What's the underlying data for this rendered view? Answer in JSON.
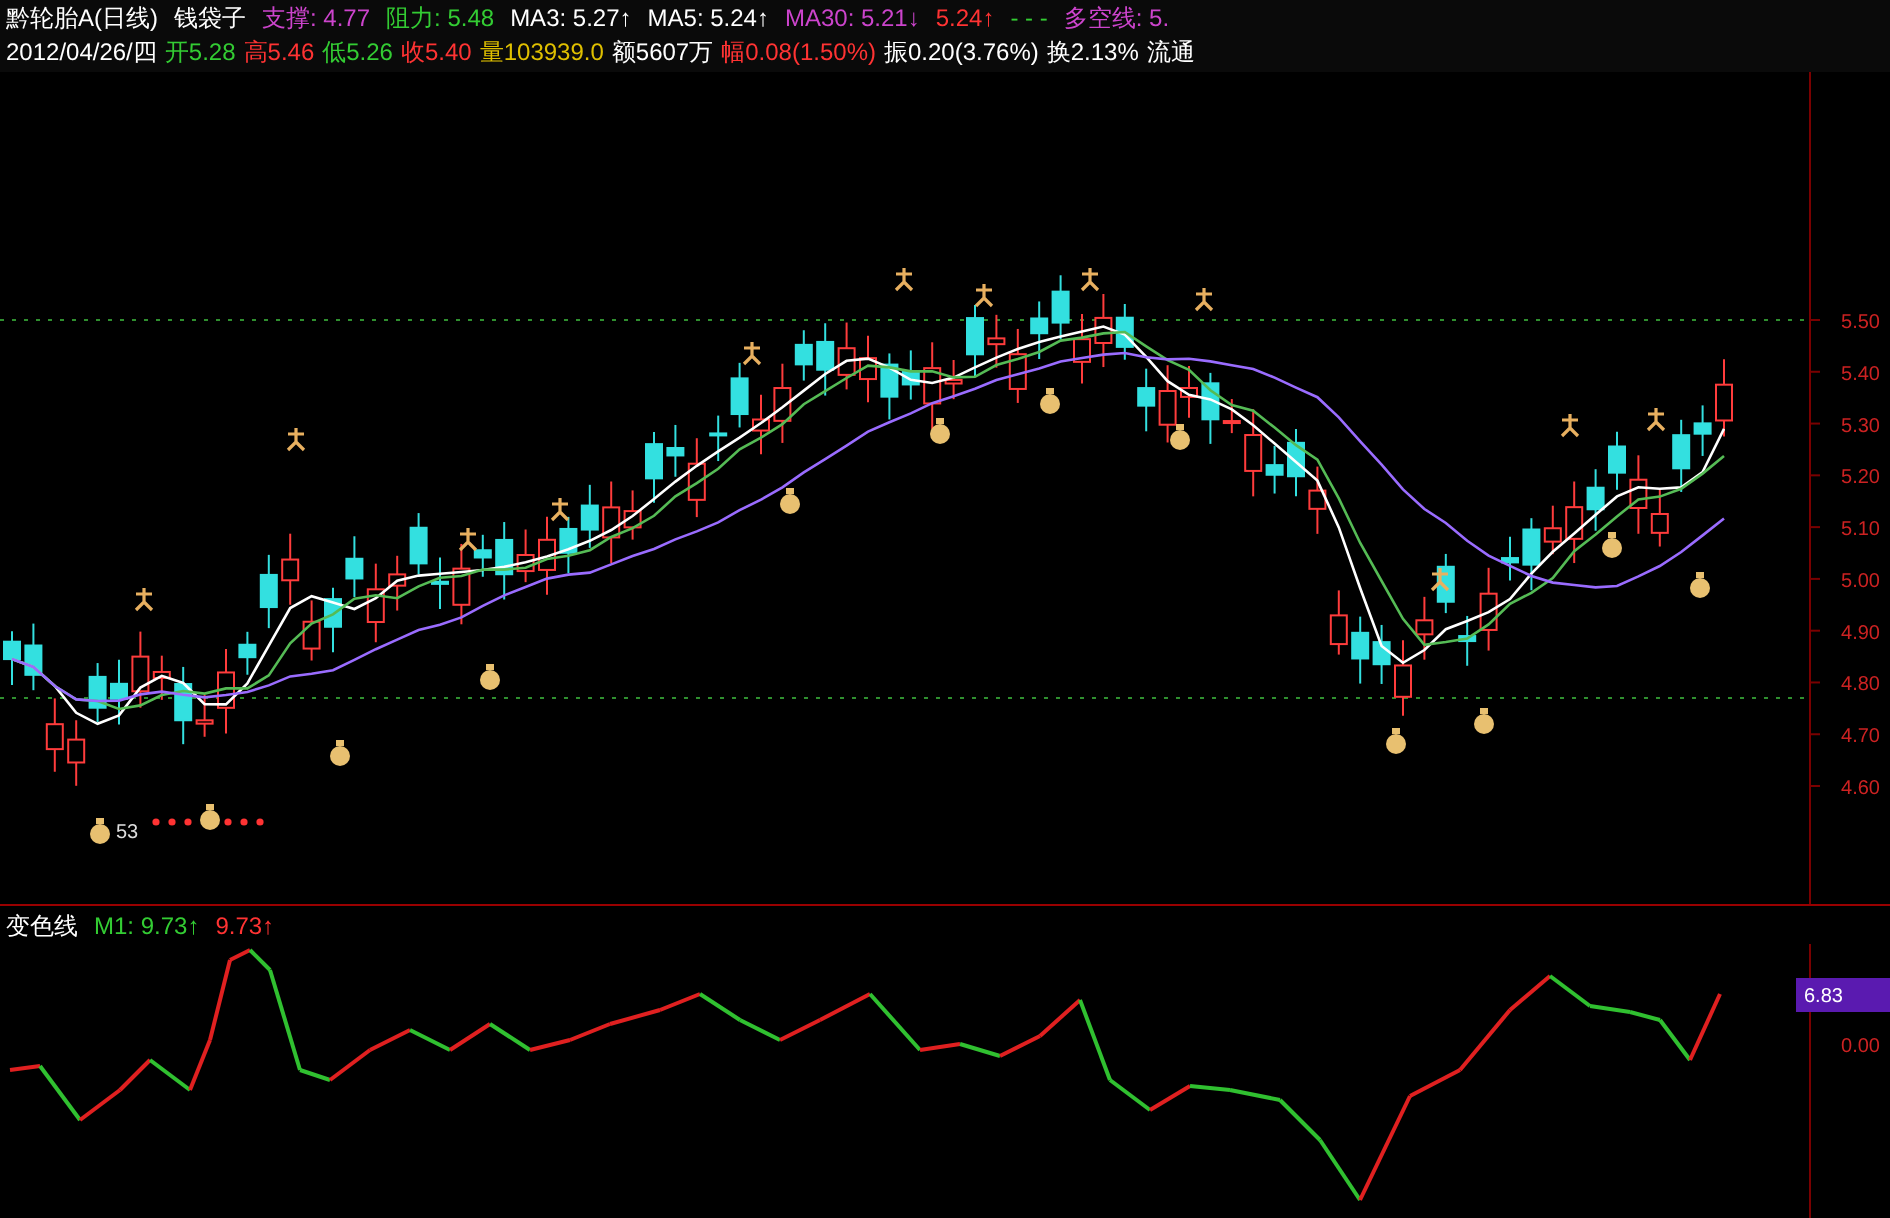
{
  "header": {
    "row_1": [
      {
        "text": "黔轮胎A(日线)",
        "color": "#ffffff"
      },
      {
        "text": "钱袋子",
        "color": "#ffffff"
      },
      {
        "text": "支撑: 4.77",
        "color": "#cc44cc"
      },
      {
        "text": "阻力: 5.48",
        "color": "#33cc33"
      },
      {
        "text": "MA3: 5.27↑",
        "color": "#ffffff"
      },
      {
        "text": "MA5: 5.24↑",
        "color": "#ffffff"
      },
      {
        "text": "MA30: 5.21↓",
        "color": "#cc44cc"
      },
      {
        "text": "5.24↑",
        "color": "#ff3333"
      },
      {
        "text": "- - -",
        "color": "#33cc33"
      },
      {
        "text": "多空线: 5.",
        "color": "#cc44cc"
      }
    ],
    "row_2": [
      {
        "text": "2012/04/26/四",
        "color": "#ffffff"
      },
      {
        "text": "开5.28",
        "color": "#33cc33"
      },
      {
        "text": "高5.46",
        "color": "#ff3333"
      },
      {
        "text": "低5.26",
        "color": "#33cc33"
      },
      {
        "text": "收5.40",
        "color": "#ff3333"
      },
      {
        "text": "量103939.0",
        "color": "#e0c000"
      },
      {
        "text": "额5607万",
        "color": "#ffffff"
      },
      {
        "text": "幅0.08(1.50%)",
        "color": "#ff3333"
      },
      {
        "text": "振0.20(3.76%)",
        "color": "#ffffff"
      },
      {
        "text": "换2.13%",
        "color": "#ffffff"
      },
      {
        "text": "流通",
        "color": "#ffffff"
      }
    ]
  },
  "price_axis": {
    "ticks": [
      "5.50",
      "5.40",
      "5.30",
      "5.20",
      "5.10",
      "5.00",
      "4.90",
      "4.80",
      "4.70",
      "4.60"
    ]
  },
  "low_marker": "53",
  "indicator": {
    "header": [
      {
        "text": "变色线",
        "color": "#ffffff"
      },
      {
        "text": "M1: 9.73↑",
        "color": "#33cc33"
      },
      {
        "text": "9.73↑",
        "color": "#ff3333"
      }
    ],
    "current_value": "6.83",
    "zero_tick": "0.00"
  }
}
